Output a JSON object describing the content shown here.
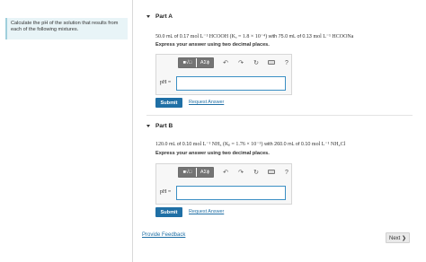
{
  "instruction": "Calculate the pH of the solution that results from each of the following mixtures.",
  "partA": {
    "title": "Part A",
    "q_amount1": "50.0",
    "q_unit1": "mL of 0.17",
    "q_expr1": "mol L⁻¹ HCOOH (Kₐ = 1.8 × 10⁻⁴)",
    "q_with": "with 75.0",
    "q_unit2": "mL of 0.13",
    "q_expr2": "mol L⁻¹ HCOONa",
    "directions": "Express your answer using two decimal places.",
    "input_label": "pH =",
    "input_value": "",
    "submit": "Submit",
    "request": "Request Answer"
  },
  "partB": {
    "title": "Part B",
    "q_amount1": "120.0",
    "q_unit1": "mL of 0.10",
    "q_expr1": "mol L⁻¹ NH₃ (Kᵦ = 1.76 × 10⁻⁵)",
    "q_with": "with 260.0",
    "q_unit2": "mL of 0.10",
    "q_expr2": "mol L⁻¹ NH₄Cl",
    "directions": "Express your answer using two decimal places.",
    "input_label": "pH =",
    "input_value": "",
    "submit": "Submit",
    "request": "Request Answer"
  },
  "toolbar": {
    "templates_label": "■√□",
    "symbols_label": "AΣϕ",
    "undo_icon": "↶",
    "redo_icon": "↷",
    "reset_icon": "↻",
    "help_label": "?"
  },
  "footer": {
    "feedback": "Provide Feedback",
    "next": "Next ❯"
  }
}
